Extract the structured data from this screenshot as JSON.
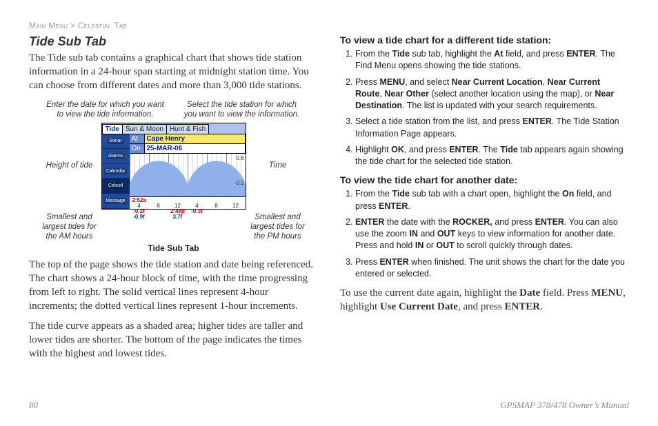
{
  "header": {
    "crumb1": "Main Menu",
    "sep": " > ",
    "crumb2": "Celestial Tab"
  },
  "left": {
    "title": "Tide Sub Tab",
    "intro": "The Tide sub tab contains a graphical chart that shows tide station information in a 24-hour span starting at midnight station time. You can choose from different dates and more than 3,000 tide stations.",
    "fig": {
      "top_left": "Enter the date for which you want to view the tide information.",
      "top_right": "Select the tide station for which you want to view the information.",
      "label_height": "Height of tide",
      "label_time": "Time",
      "label_am": "Smallest and largest tides for the AM hours",
      "label_pm": "Smallest and largest tides for the PM hours",
      "caption": "Tide Sub Tab",
      "device": {
        "tabs": [
          "Tide",
          "Sun & Moon",
          "Hunt & Fish"
        ],
        "at_label": "At",
        "at_value": "Cape Henry",
        "on_label": "On",
        "on_value": "25-MAR-06",
        "side_items": [
          "Sonar",
          "Alarms",
          "Calendar",
          "Celestl",
          "Message"
        ],
        "y_ticks": [
          "0.6",
          "-0.2"
        ],
        "x_hours": [
          "4",
          "8",
          "12",
          "4",
          "8",
          "12"
        ],
        "cols": [
          {
            "time": "2:52a",
            "hi": "-0.2f",
            "lo": "-0.9f"
          },
          {
            "time": "",
            "hi": "",
            "lo": ""
          },
          {
            "time": "",
            "hi": "2:48p",
            "lo": "3.7f"
          },
          {
            "time": "",
            "hi": "-0.3f",
            "lo": ""
          }
        ]
      }
    },
    "para2": "The top of the page shows the tide station and date being referenced. The chart shows a 24-hour block of time, with the time progressing from left to right. The solid vertical lines represent 4-hour increments; the dotted vertical lines represent 1-hour increments.",
    "para3": "The tide curve appears as a shaded area; higher tides are taller and lower tides are shorter. The bottom of the page indicates the times with the highest and lowest tides."
  },
  "right": {
    "h1": "To view a tide chart for a different tide station:",
    "steps1": [
      {
        "pre": "From the ",
        "b1": "Tide",
        "mid1": " sub tab, highlight the ",
        "b2": "At",
        "mid2": " field, and press ",
        "b3": "ENTER",
        "post": ". The Find Menu opens showing the tide stations."
      },
      {
        "pre": "Press ",
        "b1": "MENU",
        "mid1": ", and select ",
        "b2": "Near Current Location",
        "mid2": ", ",
        "b3": "Near Current Route",
        "mid3": ", ",
        "b4": "Near Other",
        "mid4": " (select another location using the map), or ",
        "b5": "Near Destination",
        "post": ". The list is updated with your search requirements."
      },
      {
        "pre": "Select a tide station from the list, and press ",
        "b1": "ENTER",
        "post": ". The Tide Station Information Page appears."
      },
      {
        "pre": "Highlight ",
        "b1": "OK",
        "mid1": ", and press ",
        "b2": "ENTER",
        "mid2": ". The ",
        "b3": "Tide",
        "post": " tab appears again showing the tide chart for the selected tide station."
      }
    ],
    "h2": "To view the tide chart for another date:",
    "steps2": [
      {
        "pre": "From the ",
        "b1": "Tide",
        "mid1": " sub tab with a chart open, highlight the ",
        "b2": "On",
        "mid2": " field, and press ",
        "b3": "ENTER",
        "post": "."
      },
      {
        "b0": "ENTER",
        "pre": " the date with the ",
        "b1": "ROCKER,",
        "mid1": " and press ",
        "b2": "ENTER",
        "mid2": ". You can also use the zoom ",
        "b3": "IN",
        "mid3": " and ",
        "b4": "OUT",
        "mid4": " keys to view information for another date. Press and hold ",
        "b5": "IN",
        "mid5": " or ",
        "b6": "OUT",
        "post": " to scroll quickly through dates."
      },
      {
        "pre": "Press ",
        "b1": "ENTER",
        "post": " when finished. The unit shows the chart for the date you entered or selected."
      }
    ],
    "tail": {
      "pre": "To use the current date again, highlight the ",
      "b1": "Date",
      "mid1": " field. Press ",
      "b2": "MENU",
      "mid2": ", highlight ",
      "b3": "Use Current Date",
      "mid3": ", and press ",
      "b4": "ENTER",
      "post": "."
    }
  },
  "footer": {
    "page": "80",
    "manual": "GPSMAP 378/478 Owner’s Manual"
  }
}
